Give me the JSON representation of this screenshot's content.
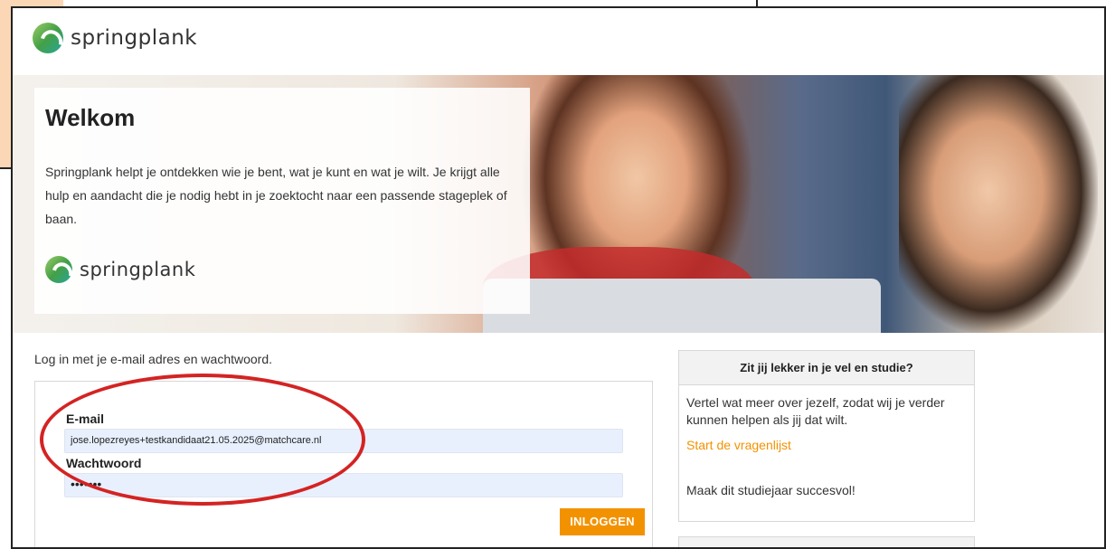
{
  "brand": {
    "name": "springplank"
  },
  "hero": {
    "title": "Welkom",
    "description": "Springplank helpt je ontdekken wie je bent, wat je kunt en wat je wilt. Je krijgt alle hulp en aandacht die je nodig hebt in je zoektocht naar een passende stageplek of baan.",
    "panel_brand": "springplank"
  },
  "login": {
    "intro": "Log in met je e-mail adres en wachtwoord.",
    "email_label": "E-mail",
    "email_value": "jose.lopezreyes+testkandidaat21.05.2025@matchcare.nl",
    "password_label": "Wachtwoord",
    "password_value": "•••••••",
    "submit_label": "INLOGGEN"
  },
  "side_card": {
    "title": "Zit jij lekker in je vel en studie?",
    "text": "Vertel wat meer over jezelf, zodat wij je verder kunnen helpen als jij dat wilt.",
    "link": "Start de vragenlijst",
    "tagline": "Maak dit studiejaar succesvol!"
  },
  "colors": {
    "accent": "#f39200",
    "annotation_ellipse": "#d42323",
    "input_bg": "#e8f0fe",
    "peach_bg": "#fbd7b6"
  }
}
